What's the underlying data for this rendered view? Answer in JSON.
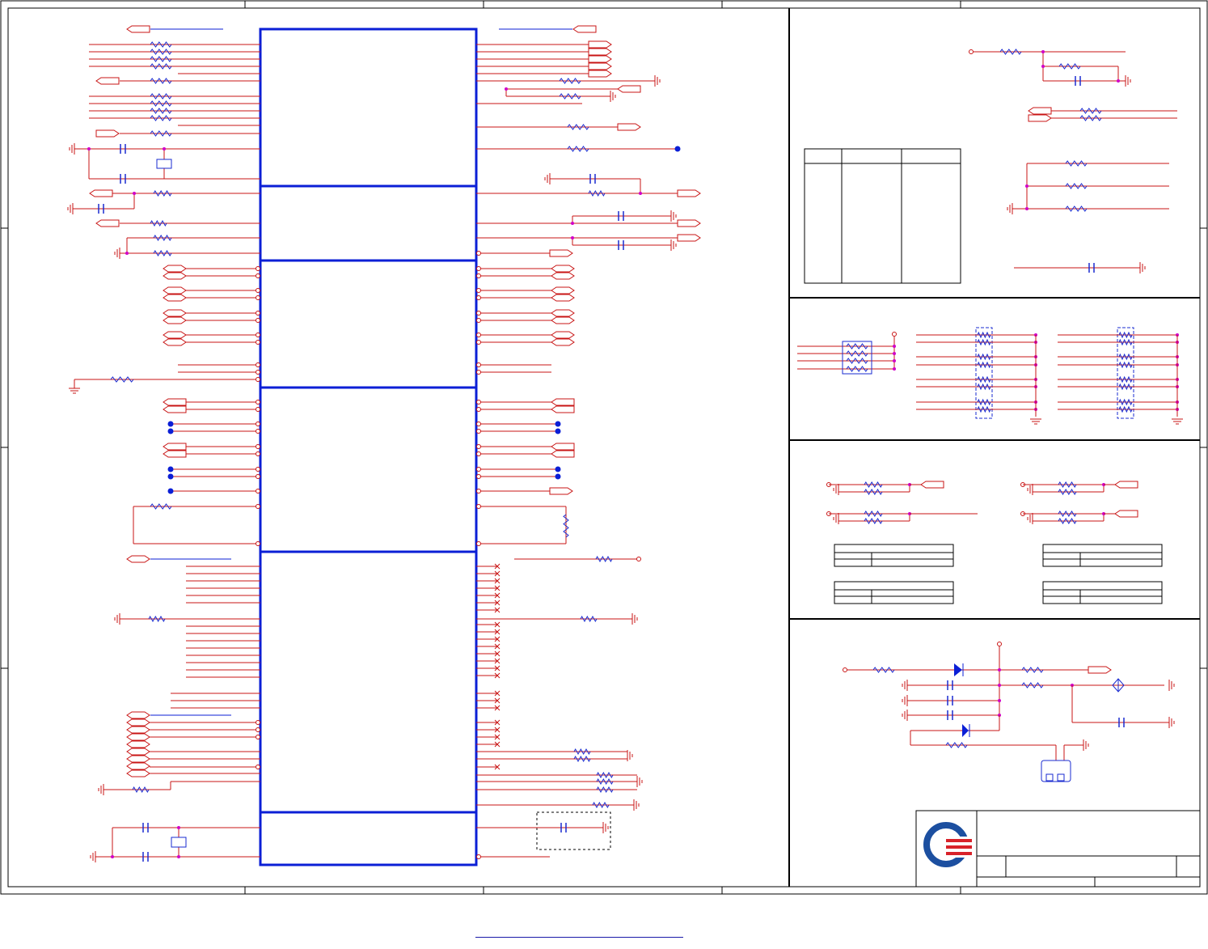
{
  "document": {
    "kind": "schematic-sheet",
    "text_legible": false
  },
  "colors": {
    "frame": "#000000",
    "component_body": "#0b1fd6",
    "wire": "#c81414",
    "resistor": "#1a2bd0",
    "junction": "#d000c8",
    "net_port": "#c81414",
    "logo_blue": "#1c4fa0",
    "logo_red": "#d8222a"
  },
  "icons": {
    "logo": "company-logo-icon",
    "ground": "ground-icon",
    "resistor": "resistor-icon",
    "capacitor": "capacitor-icon",
    "crystal": "crystal-icon",
    "diode": "diode-icon",
    "connector": "connector-icon"
  }
}
